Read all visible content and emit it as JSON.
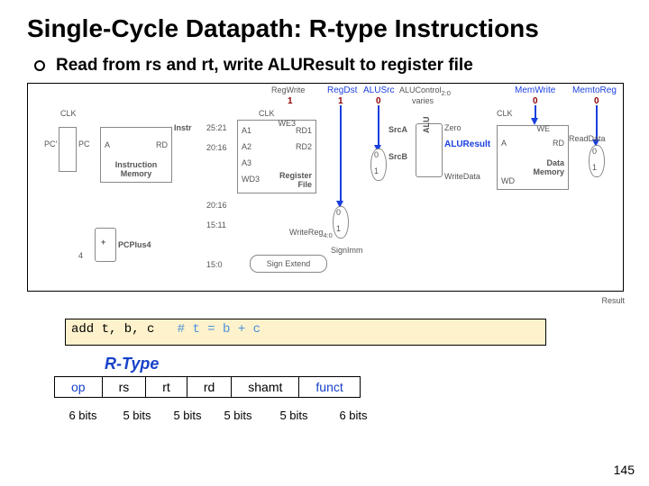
{
  "title": "Single-Cycle Datapath: R-type Instructions",
  "bullet": "Read from rs and rt,  write ALUResult to register file",
  "diagram": {
    "signals": {
      "regwrite": {
        "label": "RegWrite",
        "value": "1"
      },
      "regdst": {
        "label": "RegDst",
        "value": "1"
      },
      "alusrc": {
        "label": "ALUSrc",
        "value": "0"
      },
      "aluctrl": {
        "label": "ALUControl",
        "sub": "2:0",
        "value": "varies"
      },
      "memwrite": {
        "label": "MemWrite",
        "value": "0"
      },
      "memtoreg": {
        "label": "MemtoReg",
        "value": "0"
      }
    },
    "labels": {
      "clk1": "CLK",
      "clk2": "CLK",
      "clk3": "CLK",
      "pc_in": "PC'",
      "pc_out": "PC",
      "imem_a": "A",
      "imem_rd": "RD",
      "imem_name": "Instruction\nMemory",
      "instr": "Instr",
      "f_25_21": "25:21",
      "f_20_16": "20:16",
      "f_15_11": "15:11",
      "f_15_0": "15:0",
      "f_20_16b": "20:16",
      "rf_a1": "A1",
      "rf_a2": "A2",
      "rf_a3": "A3",
      "rf_wd3": "WD3",
      "rf_we3": "WE3",
      "rf_rd1": "RD1",
      "rf_rd2": "RD2",
      "rf_name": "Register\nFile",
      "srcA": "SrcA",
      "srcB": "SrcB",
      "alu": "ALU",
      "zero": "Zero",
      "aluresult": "ALUResult",
      "writedata": "WriteData",
      "dm_a": "A",
      "dm_rd": "RD",
      "dm_wd": "WD",
      "dm_we": "WE",
      "dm_name": "Data\nMemory",
      "readdata": "ReadData",
      "mux_rd_0": "0",
      "mux_rd_1": "1",
      "mux_src_0": "0",
      "mux_src_1": "1",
      "mux_res_0": "0",
      "mux_res_1": "1",
      "signext": "Sign Extend",
      "signimm": "SignImm",
      "plus": "+",
      "four": "4",
      "pcplus4": "PCPlus4",
      "writereg": "WriteReg",
      "writeregsub": "4:0",
      "result": "Result"
    }
  },
  "code": {
    "instr": "add t, b, c",
    "comment": "# t = b + c"
  },
  "rtype_label": "R-Type",
  "format": {
    "fields": [
      {
        "name": "op",
        "bits": "6 bits",
        "hl": true
      },
      {
        "name": "rs",
        "bits": "5 bits",
        "hl": false
      },
      {
        "name": "rt",
        "bits": "5 bits",
        "hl": false
      },
      {
        "name": "rd",
        "bits": "5 bits",
        "hl": false
      },
      {
        "name": "shamt",
        "bits": "5 bits",
        "hl": false
      },
      {
        "name": "funct",
        "bits": "6 bits",
        "hl": true
      }
    ]
  },
  "page": "145"
}
